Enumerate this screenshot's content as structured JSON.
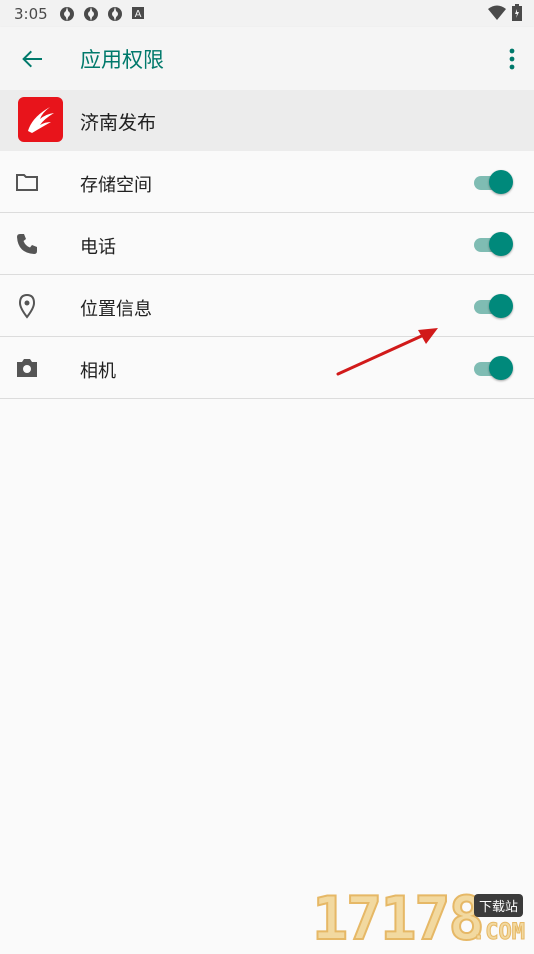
{
  "status_bar": {
    "time": "3:05",
    "left_icons": [
      "sync-icon",
      "sync-icon",
      "sync-icon",
      "a-box-icon"
    ],
    "right_icons": [
      "wifi-icon",
      "battery-icon"
    ]
  },
  "app_bar": {
    "title": "应用权限",
    "back_icon": "arrow-left-icon",
    "overflow_icon": "more-vert-icon",
    "accent_color": "#00796b"
  },
  "app_header": {
    "name": "济南发布",
    "icon_color": "#e8141b"
  },
  "permissions": [
    {
      "label": "存储空间",
      "icon": "folder-icon",
      "enabled": true
    },
    {
      "label": "电话",
      "icon": "phone-icon",
      "enabled": true
    },
    {
      "label": "位置信息",
      "icon": "location-pin-icon",
      "enabled": true
    },
    {
      "label": "相机",
      "icon": "camera-icon",
      "enabled": true
    }
  ],
  "switch_colors": {
    "thumb": "#00897b",
    "track": "#7fbcb3"
  },
  "annotation": {
    "type": "red-arrow-icon",
    "color": "#d11a1a"
  },
  "watermark": {
    "digits": "17178",
    "badge": "下载站",
    "suffix": ".COM"
  }
}
